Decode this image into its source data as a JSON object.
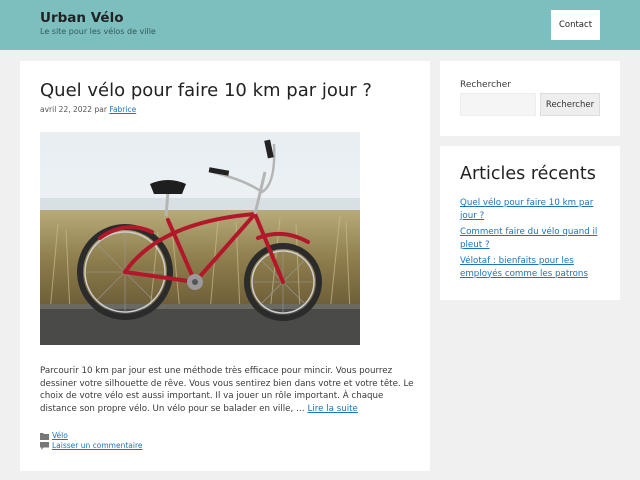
{
  "header": {
    "site_title": "Urban Vélo",
    "site_description": "Le site pour les vélos de ville",
    "nav_contact": "Contact",
    "background_color": "#7dbfbf"
  },
  "post": {
    "title": "Quel vélo pour faire 10 km par jour ?",
    "date": "avril 22, 2022",
    "by": "par",
    "author": "Fabrice",
    "excerpt": "Parcourir 10 km par jour est une méthode très efficace pour mincir. Vous pourrez dessiner votre silhouette de rêve. Vous vous sentirez bien dans votre et votre tête. Le choix de votre vélo est aussi important. Il va jouer un rôle important. À chaque distance son propre vélo. Un vélo pour se balader en ville, …",
    "read_more": "Lire la suite",
    "category": "Vélo",
    "comment_link": "Laisser un commentaire",
    "category_icon": "folder-icon",
    "comment_icon": "comment-icon"
  },
  "sidebar": {
    "search": {
      "label": "Rechercher",
      "button": "Rechercher",
      "value": ""
    },
    "recent": {
      "title": "Articles récents",
      "items": [
        "Quel vélo pour faire 10 km par jour ?",
        "Comment faire du vélo quand il pleut ?",
        "Vélotaf : bienfaits pour les employés comme les patrons"
      ]
    }
  },
  "colors": {
    "link": "#1e73be",
    "page_background": "#f0f0f0"
  }
}
